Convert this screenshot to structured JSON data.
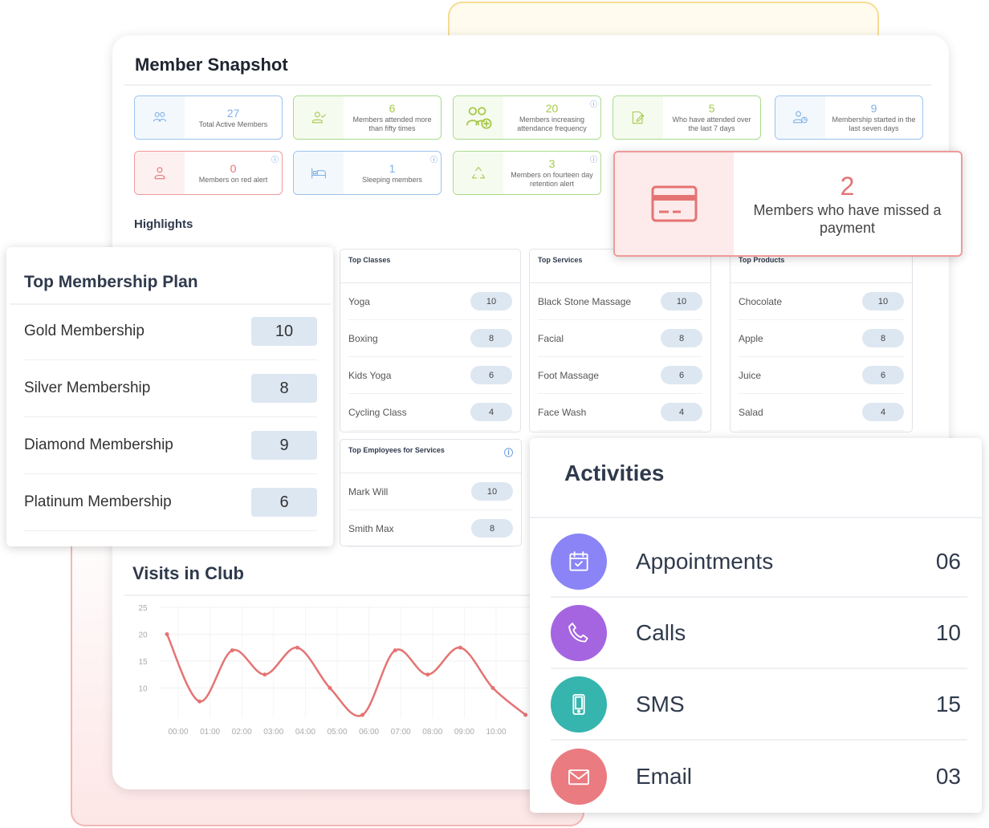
{
  "snapshot": {
    "title": "Member Snapshot",
    "stats": [
      {
        "value": "27",
        "label": "Total Active Members",
        "color": "blue",
        "icon": "users-group-icon",
        "info": false
      },
      {
        "value": "6",
        "label": "Members attended more than fifty times",
        "color": "green",
        "icon": "user-check-icon",
        "info": false
      },
      {
        "value": "20",
        "label": "Members increasing attendance frequency",
        "color": "green",
        "icon": "users-plus-icon",
        "info": true
      },
      {
        "value": "5",
        "label": "Who have attended over the last 7 days",
        "color": "green",
        "icon": "edit-document-icon",
        "info": false
      },
      {
        "value": "9",
        "label": "Membership started in the last seven days",
        "color": "blue",
        "icon": "user-clock-icon",
        "info": false
      },
      {
        "value": "0",
        "label": "Members on red alert",
        "color": "red",
        "icon": "user-icon",
        "info": true
      },
      {
        "value": "1",
        "label": "Sleeping members",
        "color": "blue",
        "icon": "bed-icon",
        "info": true
      },
      {
        "value": "3",
        "label": "Members on fourteen day retention alert",
        "color": "green",
        "icon": "recycle-icon",
        "info": true
      }
    ],
    "missed_payment": {
      "value": "2",
      "label": "Members who have missed a payment",
      "icon": "credit-card-icon"
    }
  },
  "highlights": {
    "title": "Highlights",
    "tables": [
      {
        "title": "Top Classes",
        "rows": [
          [
            "Yoga",
            "10"
          ],
          [
            "Boxing",
            "8"
          ],
          [
            "Kids Yoga",
            "6"
          ],
          [
            "Cycling Class",
            "4"
          ]
        ]
      },
      {
        "title": "Top Services",
        "rows": [
          [
            "Black Stone Massage",
            "10"
          ],
          [
            "Facial",
            "8"
          ],
          [
            "Foot Massage",
            "6"
          ],
          [
            "Face Wash",
            "4"
          ]
        ]
      },
      {
        "title": "Top Products",
        "rows": [
          [
            "Chocolate",
            "10"
          ],
          [
            "Apple",
            "8"
          ],
          [
            "Juice",
            "6"
          ],
          [
            "Salad",
            "4"
          ]
        ]
      }
    ],
    "employees": {
      "title": "Top Employees for Services",
      "rows": [
        [
          "Mark Will",
          "10"
        ],
        [
          "Smith Max",
          "8"
        ]
      ]
    }
  },
  "membership_plan": {
    "title": "Top Membership Plan",
    "rows": [
      [
        "Gold Membership",
        "10"
      ],
      [
        "Silver Membership",
        "8"
      ],
      [
        "Diamond Membership",
        "9"
      ],
      [
        "Platinum Membership",
        "6"
      ]
    ]
  },
  "activities": {
    "title": "Activities",
    "items": [
      {
        "label": "Appointments",
        "count": "06",
        "color": "#8a84f7",
        "icon": "calendar-check-icon"
      },
      {
        "label": "Calls",
        "count": "10",
        "color": "#a565e0",
        "icon": "phone-icon"
      },
      {
        "label": "SMS",
        "count": "15",
        "color": "#35b5ae",
        "icon": "mobile-phone-icon"
      },
      {
        "label": "Email",
        "count": "03",
        "color": "#ea7b80",
        "icon": "envelope-icon"
      }
    ]
  },
  "chart_data": {
    "type": "line",
    "title": "Visits in Club",
    "x_ticks": [
      "00:00",
      "01:00",
      "02:00",
      "03:00",
      "04:00",
      "05:00",
      "06:00",
      "07:00",
      "08:00",
      "09:00",
      "10:00"
    ],
    "y_ticks": [
      "25",
      "20",
      "15",
      "10"
    ],
    "ylim": [
      5,
      25
    ],
    "values": [
      20,
      7.5,
      17,
      12.5,
      17.5,
      10,
      5,
      17,
      12.5,
      17.5,
      10,
      5
    ],
    "color": "#e57373",
    "grid": true
  }
}
